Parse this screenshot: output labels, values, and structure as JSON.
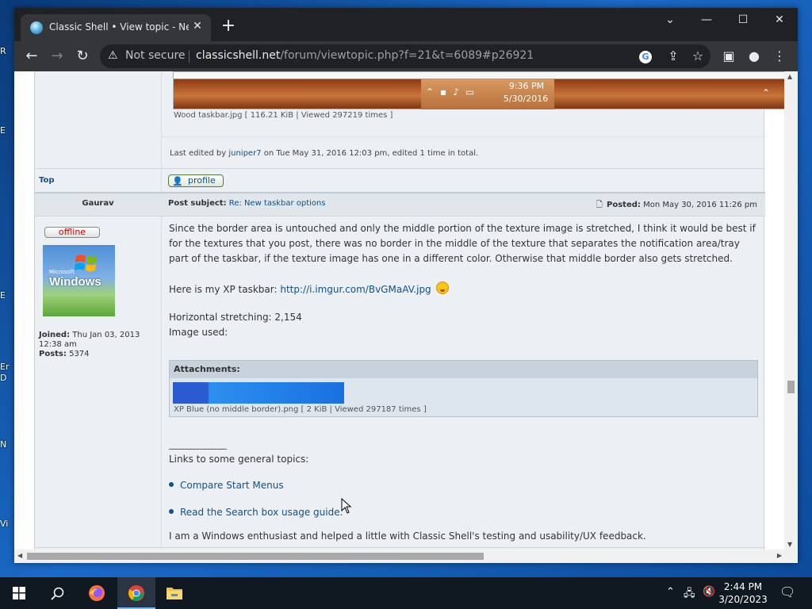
{
  "desktop": {
    "icon_labels": [
      "R",
      "E",
      "E",
      "Er",
      "D",
      "N",
      "Vi"
    ]
  },
  "browser": {
    "tab_title": "Classic Shell • View topic - New t",
    "not_secure": "Not secure",
    "url_domain": "classicshell.net",
    "url_path": "/forum/viewtopic.php?f=21&t=6089#p26921"
  },
  "previous_post": {
    "tray_time": "9:36 PM",
    "tray_date": "5/30/2016",
    "attachment_caption": "Wood taskbar.jpg [ 116.21 KiB | Viewed 297219 times ]",
    "last_edit_prefix": "Last edited by",
    "last_edit_user": "juniper7",
    "last_edit_suffix": "on Tue May 31, 2016 12:03 pm, edited 1 time in total.",
    "top_link": "Top",
    "profile_button": "profile"
  },
  "post": {
    "author": "Gaurav",
    "subject_label": "Post subject:",
    "subject": "Re: New taskbar options",
    "posted_label": "Posted:",
    "posted_date": "Mon May 30, 2016 11:26 pm",
    "status": "offline",
    "avatar_small": "Microsoft",
    "avatar_big": "Windows",
    "joined_label": "Joined:",
    "joined_value": "Thu Jan 03, 2013 12:38 am",
    "posts_label": "Posts:",
    "posts_value": "5374",
    "body_p1": "Since the border area is untouched and only the middle portion of the texture image is stretched, I think it would be best if for the textures that you post, there was no border in the middle of the texture that separates the notification area/tray part of the taskbar, if the texture image has one in a different color. Otherwise that middle border also gets stretched.",
    "body_p2_prefix": "Here is my XP taskbar:",
    "body_p2_link": "http://i.imgur.com/BvGMaAV.jpg",
    "body_p3": "Horizontal stretching: 2,154",
    "body_p4": "Image used:",
    "attachments_title": "Attachments:",
    "attachment_caption": "XP Blue (no middle border).png [ 2 KiB | Viewed 297187 times ]",
    "sig_rule": "________________",
    "sig_links_title": "Links to some general topics:",
    "sig_link1": "Compare Start Menus",
    "sig_link2": "Read the Search box usage guide.",
    "sig_footer": "I am a Windows enthusiast and helped a little with Classic Shell's testing and usability/UX feedback."
  },
  "taskbar": {
    "time": "2:44 PM",
    "date": "3/20/2023"
  }
}
